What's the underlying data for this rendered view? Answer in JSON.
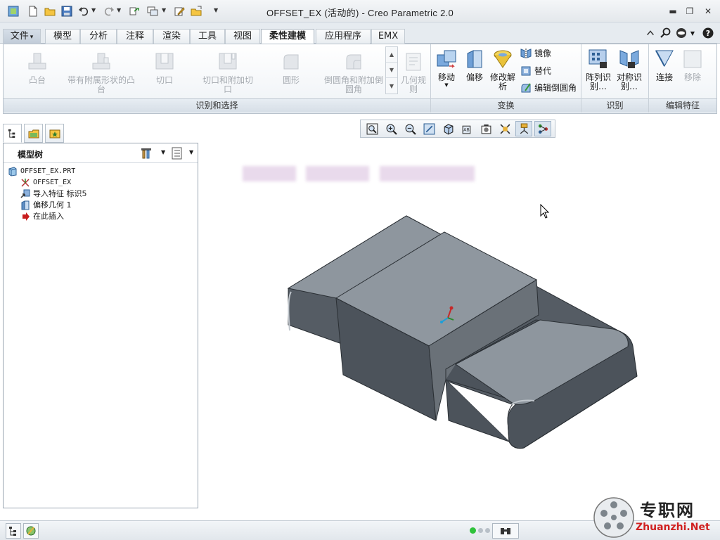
{
  "title": "OFFSET_EX (活动的) - Creo Parametric 2.0",
  "tabs": [
    {
      "label": "文件",
      "type": "file"
    },
    {
      "label": "模型"
    },
    {
      "label": "分析"
    },
    {
      "label": "注释"
    },
    {
      "label": "渲染"
    },
    {
      "label": "工具"
    },
    {
      "label": "视图"
    },
    {
      "label": "柔性建模",
      "active": true
    },
    {
      "label": "应用程序"
    },
    {
      "label": "EMX"
    }
  ],
  "file_arrow": "▾",
  "ribbon": {
    "shape_surfaces": {
      "boss": "凸台",
      "boss_attached": "带有附属形状的凸台",
      "cut": "切口",
      "cut_attached": "切口和附加切口",
      "round": "圆形",
      "round_attached": "倒圆角和附加倒圆角",
      "geometry_rule": "几何规则"
    },
    "transform": {
      "move": "移动",
      "offset": "偏移",
      "modify_analytic": "修改解析",
      "mirror": "镜像",
      "substitute": "替代",
      "edit_round": "编辑倒圆角"
    },
    "recognize": {
      "pattern_recognize": "阵列识别…",
      "symmetry_recognize": "对称识别…"
    },
    "edit_features": {
      "attach": "连接",
      "remove": "移除"
    },
    "groups": {
      "recognize_select": "识别和选择",
      "transform": "变换",
      "recognize": "识别",
      "edit_features": "编辑特征"
    }
  },
  "model_tree": {
    "title": "模型树",
    "items": [
      {
        "label": "OFFSET_EX.PRT",
        "icon": "part-icon"
      },
      {
        "label": "OFFSET_EX",
        "icon": "csys-icon"
      },
      {
        "label": "导入特征 标识5",
        "icon": "import-feature-icon"
      },
      {
        "label": "偏移几何 1",
        "icon": "offset-geometry-icon"
      },
      {
        "label": "在此插入",
        "icon": "insert-here-arrow-icon"
      }
    ]
  },
  "watermark": {
    "top": "专职网",
    "bottom": "Zhuanzhi.Net"
  },
  "colors": {
    "accent": "#2f6db5",
    "model_face_top": "#8e969e",
    "model_face_side": "#4c535b",
    "model_edge": "#2a2f34"
  }
}
